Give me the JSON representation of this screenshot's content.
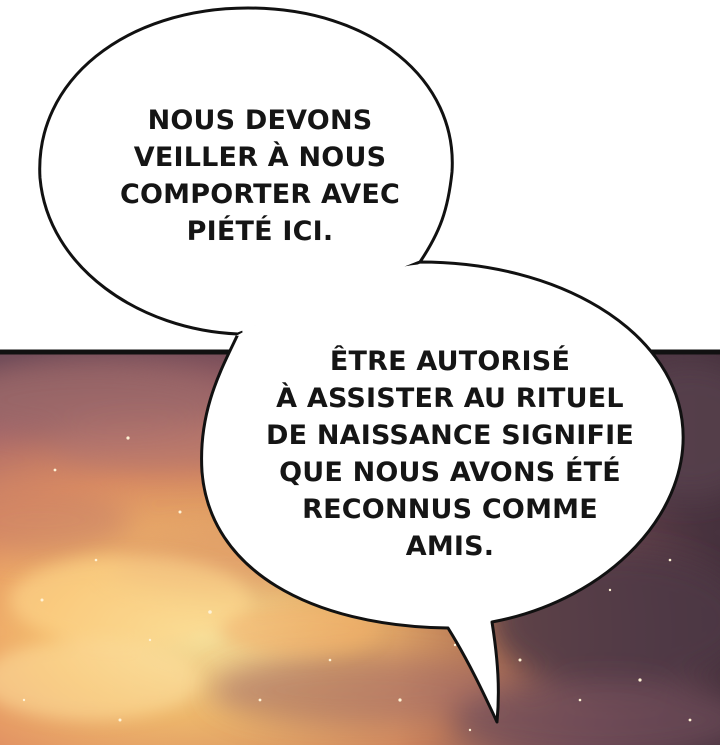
{
  "panel": {
    "sky_colors": {
      "glow": "#ffe9a0",
      "warm": "#f2a15a",
      "rose": "#c9776b",
      "dusk": "#7a5360",
      "shadow": "#4f3947",
      "deep": "#3a2a35"
    },
    "border_color": "#111111",
    "bubble_fill": "#ffffff"
  },
  "bubbles": [
    {
      "id": "top",
      "lines": [
        "NOUS DEVONS",
        "VEILLER À NOUS",
        "COMPORTER AVEC",
        "PIÉTÉ ICI."
      ]
    },
    {
      "id": "bottom",
      "lines": [
        "ÊTRE AUTORISÉ",
        "À ASSISTER AU RITUEL",
        "DE NAISSANCE SIGNIFIE",
        "QUE NOUS AVONS ÉTÉ",
        "RECONNUS COMME",
        "AMIS."
      ]
    }
  ]
}
